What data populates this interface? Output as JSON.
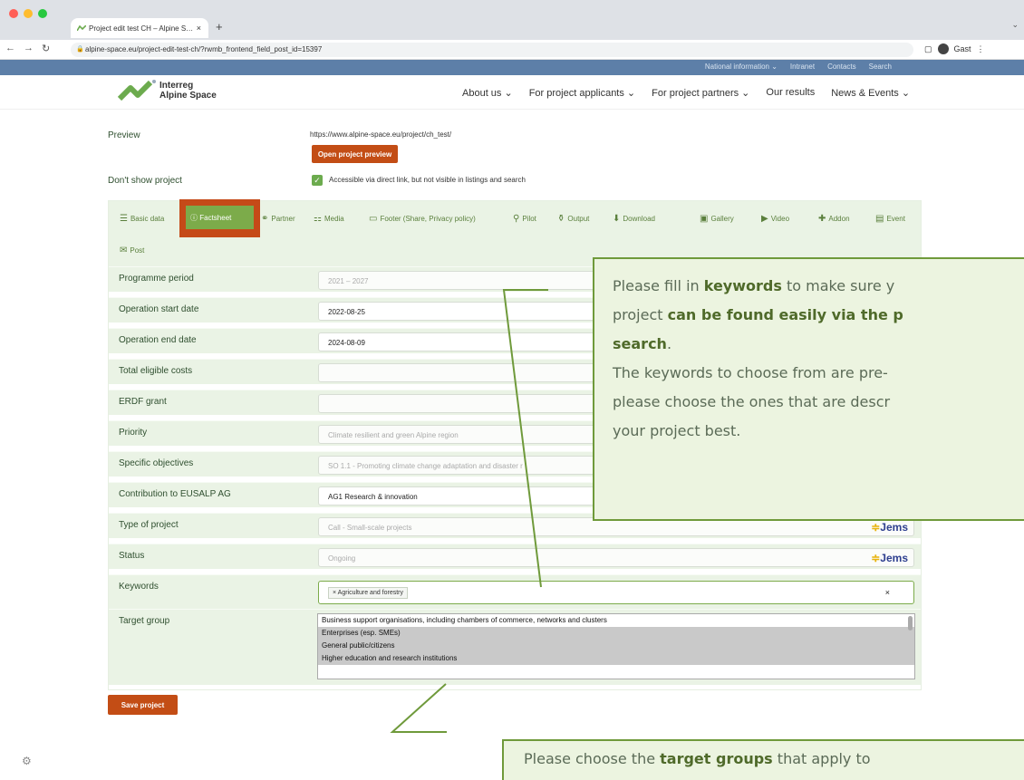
{
  "browser": {
    "tab_title": "Project edit test CH – Alpine S…",
    "url": "alpine-space.eu/project-edit-test-ch/?rwmb_frontend_field_post_id=15397",
    "profile": "Gast"
  },
  "site": {
    "top_links": [
      "National information ⌄",
      "Intranet",
      "Contacts",
      "Search"
    ],
    "logo_line1": "Interreg",
    "logo_line2": "Alpine Space",
    "main_nav": [
      "About us ⌄",
      "For project applicants ⌄",
      "For project partners ⌄",
      "Our results",
      "News & Events ⌄"
    ]
  },
  "form": {
    "preview_label": "Preview",
    "preview_url": "https://www.alpine-space.eu/project/ch_test/",
    "open_preview": "Open project preview",
    "dont_show_label": "Don't show project",
    "dont_show_text": "Accessible via direct link, but not visible in listings and search",
    "tabs": [
      "Basic data",
      "Factsheet",
      "Partner",
      "Media",
      "Footer (Share, Privacy policy)",
      "Pilot",
      "Output",
      "Download",
      "Gallery",
      "Video",
      "Addon",
      "Event",
      "Post"
    ],
    "rows": [
      {
        "label": "Programme period",
        "value": "2021 – 2027"
      },
      {
        "label": "Operation start date",
        "value": "2022-08-25"
      },
      {
        "label": "Operation end date",
        "value": "2024-08-09"
      },
      {
        "label": "Total eligible costs",
        "value": ""
      },
      {
        "label": "ERDF grant",
        "value": ""
      },
      {
        "label": "Priority",
        "value": "Climate resilient and green Alpine region"
      },
      {
        "label": "Specific objectives",
        "value": "SO 1.1 - Promoting climate change adaptation and disaster r"
      },
      {
        "label": "Contribution to EUSALP AG",
        "value": "AG1 Research & innovation"
      },
      {
        "label": "Type of project",
        "value": "Call - Small-scale projects",
        "badge": "Jems"
      },
      {
        "label": "Status",
        "value": "Ongoing",
        "badge": "Jems"
      },
      {
        "label": "Keywords",
        "tag": "× Agriculture and forestry",
        "clear": "×"
      },
      {
        "label": "Target group"
      }
    ],
    "target_options": [
      "Business support organisations, including chambers of commerce, networks and clusters",
      "Enterprises (esp. SMEs)",
      "General public/citizens",
      "Higher education and research institutions"
    ],
    "save": "Save project"
  },
  "callouts": {
    "keywords": {
      "t1": "Please fill in ",
      "b1": "keywords",
      "t2": " to make sure y",
      "t3": "project ",
      "b2": "can be found easily via the p",
      "b3": "search",
      "t4": ".",
      "t5": "The keywords to choose from are pre-",
      "t6": "please choose the ones that are descr",
      "t7": "your project best."
    },
    "target": {
      "t1": "Please choose the ",
      "b1": "target groups",
      "t2": " that apply to"
    }
  }
}
